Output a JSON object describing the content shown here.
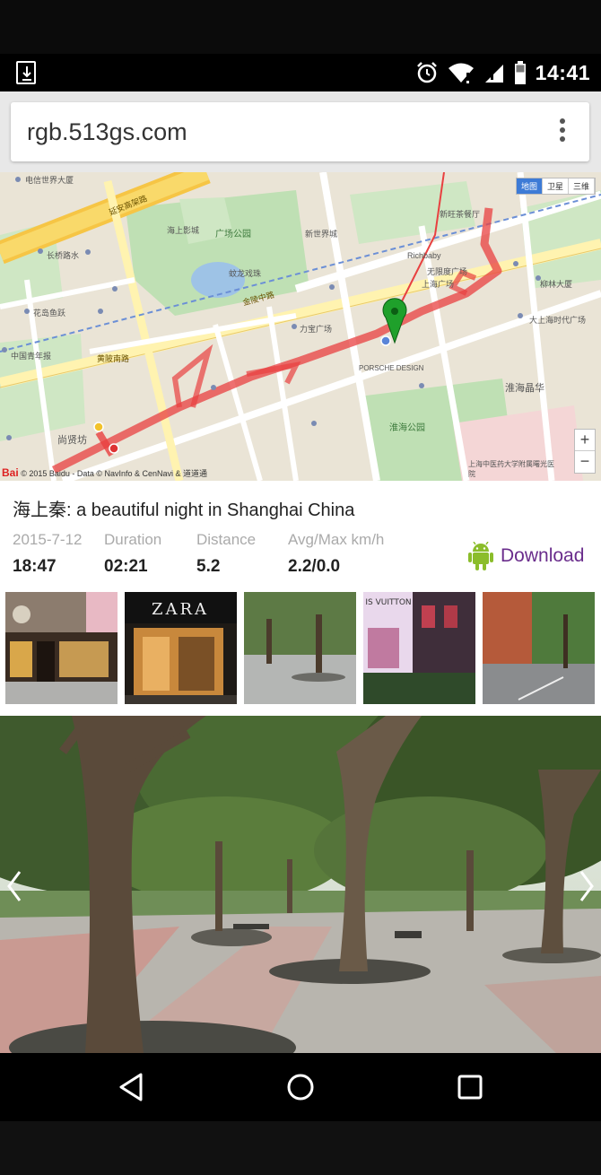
{
  "status_bar": {
    "time": "14:41",
    "icons": [
      "download-notification-icon",
      "alarm-icon",
      "wifi-icon",
      "signal-icon",
      "battery-icon"
    ]
  },
  "browser": {
    "url": "rgb.513gs.com",
    "menu_icon": "overflow-menu-icon"
  },
  "map": {
    "type_buttons": [
      "地图",
      "卫星",
      "三维"
    ],
    "zoom_in": "+",
    "zoom_out": "−",
    "copyright_logo": "Bai",
    "copyright_text": "© 2015 Baidu - Data © NavInfo & CenNavi & 道道通",
    "labels": {
      "a": "电信世界大厦",
      "b": "延安高架路",
      "c": "海上影城",
      "d": "广场公园",
      "e": "长桥路水",
      "f": "新旺茶餐厅",
      "g": "新世界城",
      "h": "蚊龙戏珠",
      "i": "无限度广场",
      "j": "上海广场",
      "k": "花岛鱼跃",
      "l": "黄陂南路",
      "m": "力宝广场",
      "n": "PORSCHE DESIGN",
      "o": "淮海晶华",
      "p": "淮海公园",
      "q": "尚贤坊",
      "r": "大上海时代广场",
      "s": "上海中医药大学附属曙光医院",
      "t": "中国青年报",
      "u": "柳林大厦",
      "v": "Richbaby",
      "w": "金陵中路"
    }
  },
  "track": {
    "title": "海上秦: a beautiful night in Shanghai China",
    "stats": [
      {
        "label": "2015-7-12",
        "value": "18:47"
      },
      {
        "label": "Duration",
        "value": "02:21"
      },
      {
        "label": "Distance",
        "value": "5.2"
      },
      {
        "label": "Avg/Max km/h",
        "value": "2.2/0.0"
      }
    ],
    "download_label": "Download",
    "download_icon": "android-icon"
  },
  "thumbnails": [
    "K11 storefront",
    "ZARA",
    "plaza with trees",
    "LOUIS VUITTON",
    "street with trees"
  ],
  "thumb_text": {
    "zara": "ZARA",
    "lv": "IS VUITTON"
  },
  "hero": {
    "prev_icon": "chevron-left-icon",
    "next_icon": "chevron-right-icon"
  },
  "nav": {
    "back_icon": "back-triangle-icon",
    "home_icon": "home-circle-icon",
    "recents_icon": "recents-square-icon"
  }
}
